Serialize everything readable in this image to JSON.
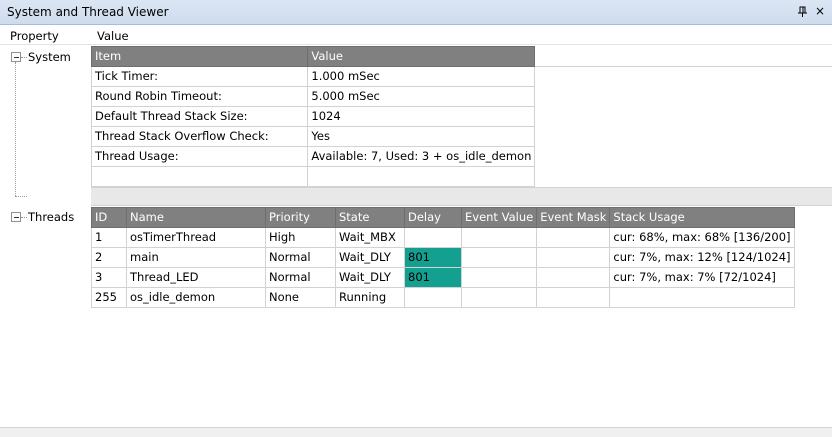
{
  "window": {
    "title": "System and Thread Viewer",
    "pin_icon": "pin-icon",
    "close_icon": "close-icon",
    "close_glyph": "×"
  },
  "columns": {
    "property": "Property",
    "value": "Value"
  },
  "tree": {
    "system_label": "System",
    "threads_label": "Threads"
  },
  "system_table": {
    "headers": [
      "Item",
      "Value"
    ],
    "rows": [
      [
        "Tick Timer:",
        "1.000 mSec"
      ],
      [
        "Round Robin Timeout:",
        "5.000 mSec"
      ],
      [
        "Default Thread Stack Size:",
        "1024"
      ],
      [
        "Thread Stack Overflow Check:",
        "Yes"
      ],
      [
        "Thread Usage:",
        "Available: 7, Used: 3 + os_idle_demon"
      ],
      [
        "",
        ""
      ]
    ]
  },
  "threads_table": {
    "headers": [
      "ID",
      "Name",
      "Priority",
      "State",
      "Delay",
      "Event Value",
      "Event Mask",
      "Stack Usage"
    ],
    "rows": [
      [
        "1",
        "osTimerThread",
        "High",
        "Wait_MBX",
        "",
        "",
        "",
        "cur: 68%, max: 68% [136/200]"
      ],
      [
        "2",
        "main",
        "Normal",
        "Wait_DLY",
        "801",
        "",
        "",
        "cur: 7%, max: 12% [124/1024]"
      ],
      [
        "3",
        "Thread_LED",
        "Normal",
        "Wait_DLY",
        "801",
        "",
        "",
        "cur: 7%, max: 7% [72/1024]"
      ],
      [
        "255",
        "os_idle_demon",
        "None",
        "Running",
        "",
        "",
        "",
        ""
      ]
    ]
  },
  "colors": {
    "header_bg": "#808080",
    "delay_highlight": "#13a091",
    "titlebar": "#dbe6f4"
  }
}
